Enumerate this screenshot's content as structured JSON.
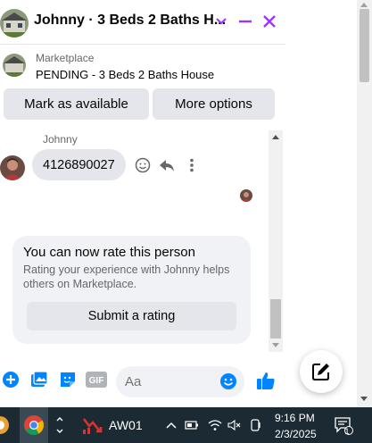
{
  "chat": {
    "title": "Johnny · 3 Beds 2 Baths H...",
    "marketplace_label": "Marketplace",
    "listing_status": "PENDING - 3 Beds 2 Baths House",
    "mark_available_label": "Mark as available",
    "more_options_label": "More options",
    "sender_name": "Johnny",
    "message_text": "4126890027",
    "rate_title": "You can now rate this person",
    "rate_description": "Rating your experience with Johnny helps others on Marketplace.",
    "rate_button_label": "Submit a rating",
    "composer_placeholder": "Aa",
    "gif_label": "GIF"
  },
  "taskbar": {
    "app_label": "AW01",
    "time": "9:16 PM",
    "date": "2/3/2025",
    "notification_count": "1"
  },
  "colors": {
    "accent_purple": "#a033ff",
    "messenger_blue": "#0084ff",
    "taskbar_bg": "#1c2a33"
  }
}
